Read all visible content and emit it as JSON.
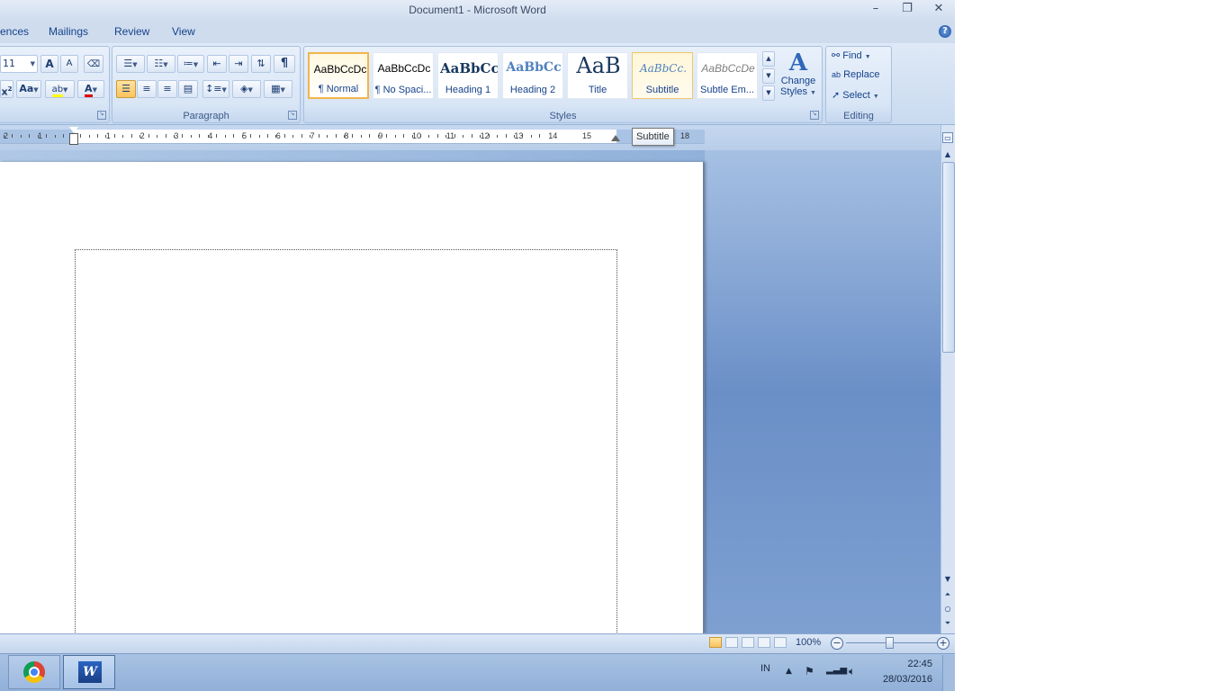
{
  "window": {
    "title": "Document1 - Microsoft Word",
    "minimize_glyph": "–",
    "maximize_glyph": "❐",
    "close_glyph": "✕"
  },
  "tabs": [
    {
      "label": "ences"
    },
    {
      "label": "Mailings"
    },
    {
      "label": "Review"
    },
    {
      "label": "View"
    }
  ],
  "help_glyph": "?",
  "font_group": {
    "font_size": "11",
    "grow_font_label": "A",
    "shrink_font_label": "A",
    "change_case_label": "Aa",
    "superscript_label": "x",
    "font_color_label": "A",
    "highlight_label": "ab"
  },
  "paragraph_group": {
    "label": "Paragraph",
    "show_marks_glyph": "¶"
  },
  "styles_group": {
    "label": "Styles",
    "items": [
      {
        "preview": "AaBbCcDc",
        "name": "¶ Normal"
      },
      {
        "preview": "AaBbCcDc",
        "name": "¶ No Spaci..."
      },
      {
        "preview": "AaBbCc",
        "name": "Heading 1"
      },
      {
        "preview": "AaBbCc",
        "name": "Heading 2"
      },
      {
        "preview": "AaB",
        "name": "Title"
      },
      {
        "preview": "AaBbCc.",
        "name": "Subtitle"
      },
      {
        "preview": "AaBbCcDe",
        "name": "Subtle Em..."
      }
    ],
    "change_styles_label_1": "Change",
    "change_styles_label_2": "Styles"
  },
  "editing_group": {
    "label": "Editing",
    "find_label": "Find",
    "replace_label": "Replace",
    "select_label": "Select"
  },
  "ruler": {
    "left_numbers": [
      "2",
      "1"
    ],
    "numbers": [
      "1",
      "2",
      "3",
      "4",
      "5",
      "6",
      "7",
      "8",
      "9",
      "10",
      "11",
      "12",
      "13",
      "14",
      "15"
    ],
    "tail_number": "18"
  },
  "tooltip": "Subtitle",
  "status": {
    "zoom": "100%"
  },
  "taskbar": {
    "language": "IN",
    "time": "22:45",
    "date": "28/03/2016"
  },
  "colors": {
    "accent": "#15428b",
    "selected_style_border": "#f2b44c",
    "font_color_bar": "#e00000",
    "highlight_bar": "#ffff00"
  }
}
